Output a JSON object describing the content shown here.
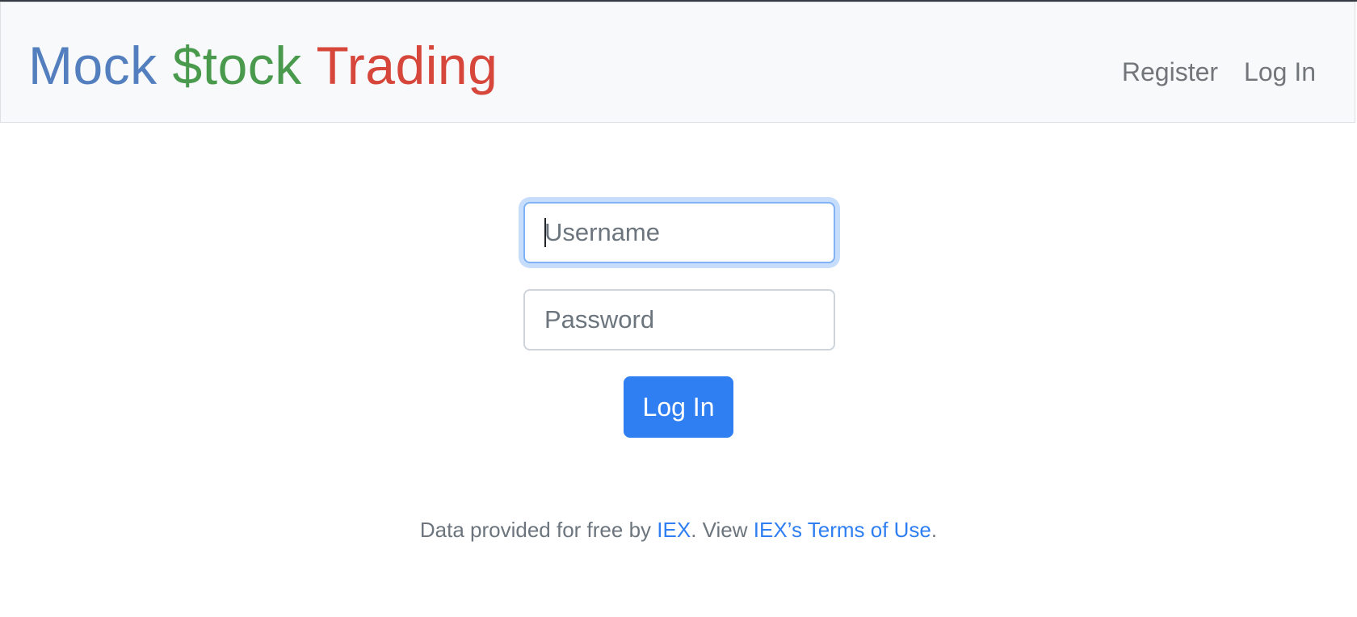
{
  "navbar": {
    "brand": {
      "word1": "Mock",
      "word2": "$tock",
      "word3": "Trading"
    },
    "links": {
      "register": "Register",
      "login": "Log In"
    }
  },
  "login_form": {
    "username_placeholder": "Username",
    "password_placeholder": "Password",
    "submit_label": "Log In"
  },
  "footer": {
    "text_prefix": "Data provided for free by",
    "iex_link": "IEX",
    "text_middle": ". View",
    "terms_link": "IEX’s Terms of Use",
    "text_suffix": "."
  },
  "colors": {
    "brand_blue": "#537fbe",
    "brand_green": "#4a9a4e",
    "brand_red": "#d6463b",
    "primary": "#2f7ff2"
  }
}
